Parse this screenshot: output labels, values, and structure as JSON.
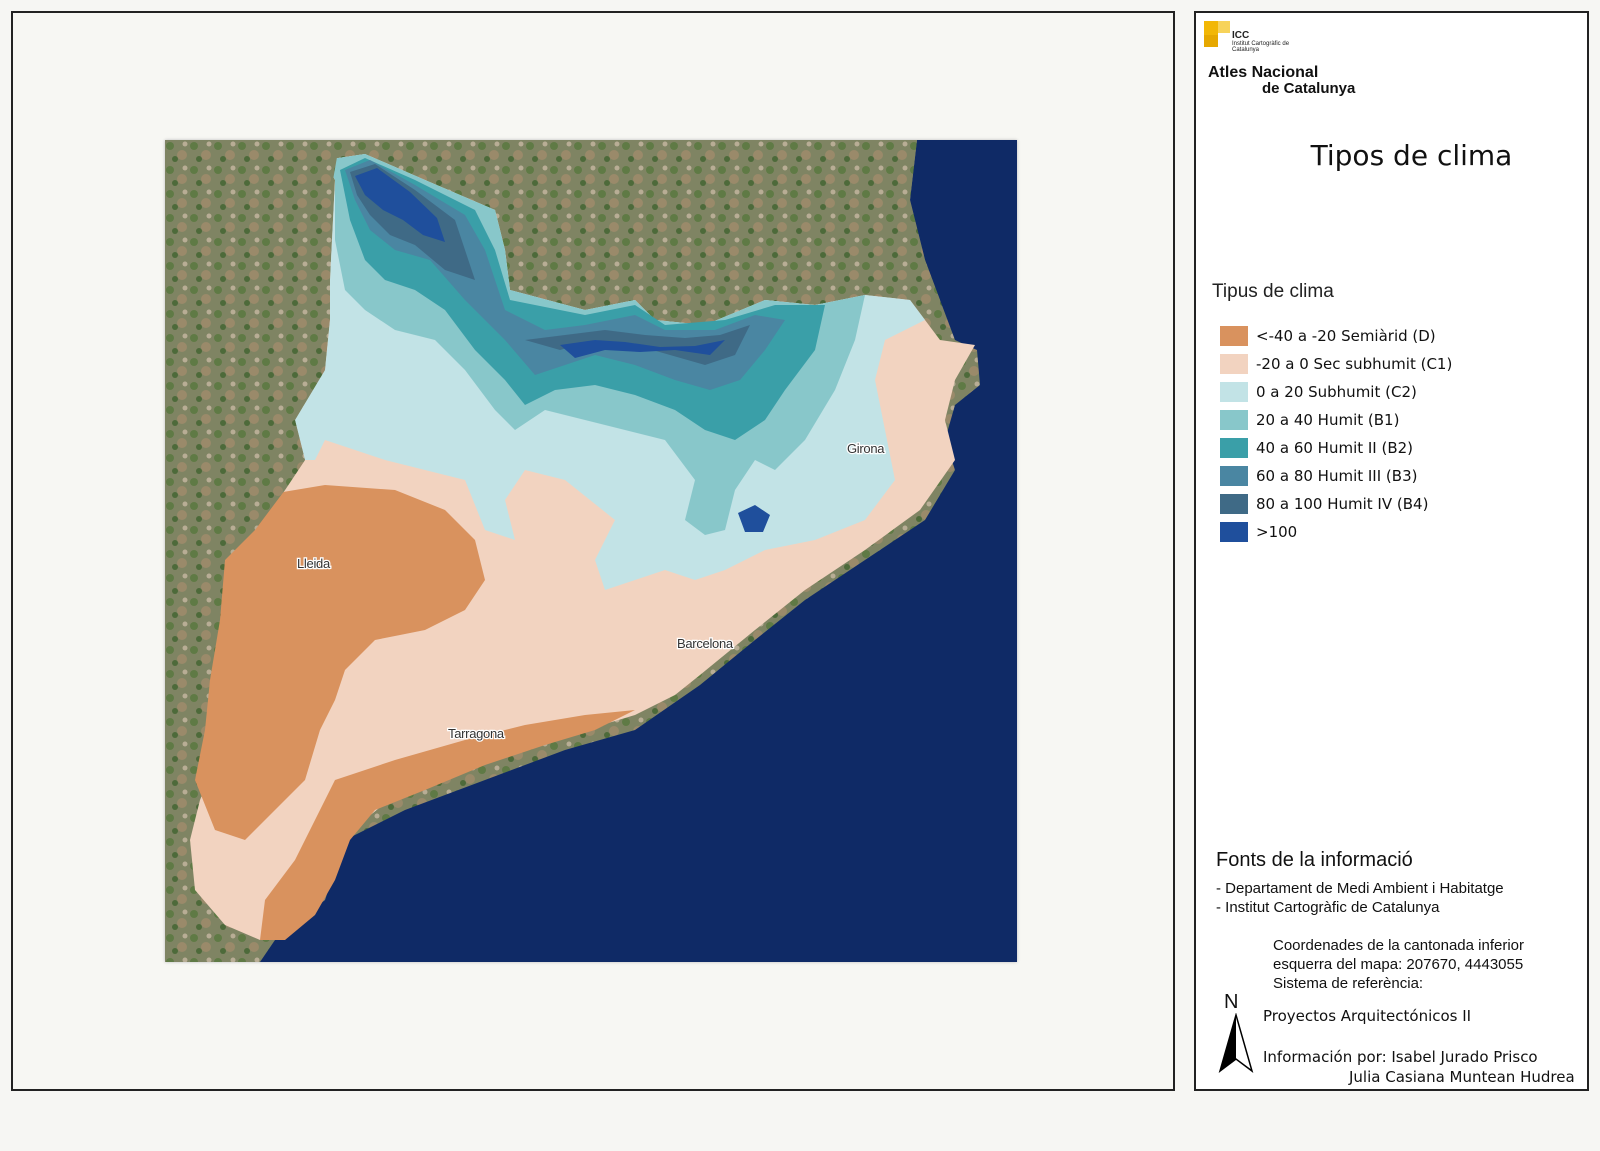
{
  "logo": {
    "abbr": "ICC",
    "institute": "Institut Cartogràfic de Catalunya",
    "line1": "Atles Nacional",
    "line2": "de Catalunya"
  },
  "panel": {
    "title": "Tipos de clima"
  },
  "legend": {
    "title": "Tipus de clima",
    "items": [
      {
        "label": "<-40 a -20 Semiàrid (D)",
        "color": "#d9925e"
      },
      {
        "label": "-20 a 0 Sec subhumit (C1)",
        "color": "#f2d3c0"
      },
      {
        "label": "0 a 20 Subhumit (C2)",
        "color": "#c2e3e6"
      },
      {
        "label": "20 a 40 Humit (B1)",
        "color": "#88c7ca"
      },
      {
        "label": "40 a 60 Humit II (B2)",
        "color": "#3a9fa8"
      },
      {
        "label": "60 a 80 Humit III (B3)",
        "color": "#4a86a2"
      },
      {
        "label": "80 a 100 Humit IV (B4)",
        "color": "#3f6a86"
      },
      {
        "label": ">100",
        "color": "#1f4f9c"
      }
    ]
  },
  "map": {
    "sea_color": "#0f2a66",
    "land_color": "#8a8d6c",
    "cities": {
      "girona": "Girona",
      "lleida": "Lleida",
      "barcelona": "Barcelona",
      "tarragona": "Tarragona"
    }
  },
  "sources": {
    "title": "Fonts de la informació",
    "line1": "- Departament de Medi Ambient i Habitatge",
    "line2": "- Institut Cartogràfic de Catalunya"
  },
  "coords": {
    "line1": "Coordenades de la cantonada inferior",
    "line2": "esquerra del mapa: 207670, 4443055",
    "line3": "Sistema de referència:"
  },
  "north": "N",
  "project": "Proyectos Arquitectónicos II",
  "credits": {
    "line1": "Información por: Isabel Jurado Prisco",
    "line2": "Julia Casiana Muntean Hudrea"
  }
}
